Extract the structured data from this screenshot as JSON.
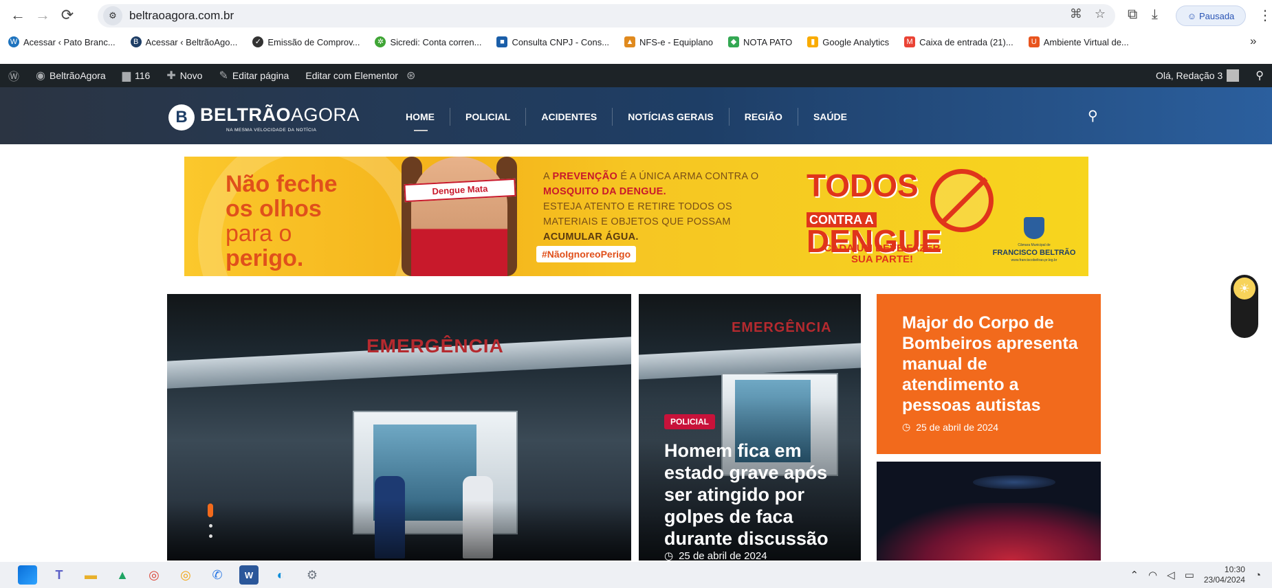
{
  "browser": {
    "url": "beltraoagora.com.br",
    "profile_label": "Pausada",
    "bookmarks": [
      {
        "label": "Acessar ‹ Pato Branc...",
        "icon": "wordpress-icon",
        "color": "#1e73be"
      },
      {
        "label": "Acessar ‹ BeltrãoAgo...",
        "icon": "beltrao-icon",
        "color": "#1e3e66"
      },
      {
        "label": "Emissão de Comprov...",
        "icon": "receipt-icon",
        "color": "#333333"
      },
      {
        "label": "Sicredi: Conta corren...",
        "icon": "sicredi-icon",
        "color": "#3fa535"
      },
      {
        "label": "Consulta CNPJ - Cons...",
        "icon": "cnpj-icon",
        "color": "#1a5ea8"
      },
      {
        "label": "NFS-e - Equiplano",
        "icon": "equiplano-icon",
        "color": "#e08a1e"
      },
      {
        "label": "NOTA PATO",
        "icon": "diamond-icon",
        "color": "#34a853"
      },
      {
        "label": "Google Analytics",
        "icon": "analytics-icon",
        "color": "#f9ab00"
      },
      {
        "label": "Caixa de entrada (21)...",
        "icon": "gmail-icon",
        "color": "#ea4335"
      },
      {
        "label": "Ambiente Virtual de...",
        "icon": "ambiente-icon",
        "color": "#e8541e"
      }
    ]
  },
  "wp_admin": {
    "site_name": "BeltrãoAgora",
    "comments_count": "116",
    "new_label": "Novo",
    "edit_page_label": "Editar página",
    "edit_elementor_label": "Editar com Elementor",
    "greeting": "Olá, Redação 3"
  },
  "site": {
    "logo_bold": "BELTRÃO",
    "logo_light": "AGORA",
    "tagline": "NA MESMA VELOCIDADE DA NOTÍCIA",
    "menu": [
      "HOME",
      "POLICIAL",
      "ACIDENTES",
      "NOTÍCIAS GERAIS",
      "REGIÃO",
      "SAÚDE"
    ]
  },
  "banner": {
    "headline_1": "Não feche",
    "headline_2": "os olhos",
    "headline_3": "para o",
    "headline_4": "perigo.",
    "blindfold": "Dengue Mata",
    "hashtag": "#NãoIgnoreoPerigo",
    "text_a": "A ",
    "text_prevencao": "PREVENÇÃO",
    "text_b": " É A ÚNICA ARMA CONTRA O",
    "text_mosquito": "MOSQUITO DA DENGUE.",
    "text_c": "ESTEJA ATENTO E RETIRE TODOS OS MATERIAIS E OBJETOS QUE POSSAM ",
    "text_agua": "ACUMULAR ÁGUA.",
    "big_1": "TODOS",
    "big_2": "CONTRA A",
    "big_3": "DENGUE",
    "cta": "CADA UM DEVE FAZER SUA PARTE!",
    "camara_small": "Câmara Municipal de",
    "camara": "FRANCISCO BELTRÃO",
    "camara_url": "www.franciscobeltrao.pr.leg.br"
  },
  "articles": {
    "main_sign": "EMERGÊNCIA",
    "mid": {
      "sign": "EMERGÊNCIA",
      "category": "POLICIAL",
      "title": "Homem fica em estado grave após ser atingido por golpes de faca durante discussão",
      "date": "25 de abril de 2024"
    },
    "orange": {
      "title": "Major do Corpo de Bombeiros apresenta manual de atendimento a pessoas autistas",
      "date": "25 de abril de 2024"
    }
  },
  "taskbar": {
    "apps": [
      "windows-start-icon",
      "teams-icon",
      "file-explorer-icon",
      "google-drive-icon",
      "chrome-icon",
      "chrome-profile-icon",
      "whatsapp-icon",
      "word-icon",
      "edge-icon",
      "settings-icon"
    ],
    "time": "10:30",
    "date": "23/04/2024"
  },
  "colors": {
    "accent_orange": "#f26a1c",
    "policial_badge": "#c8123a",
    "wp_bar": "#1d2327",
    "header_blue": "#1e3e66"
  }
}
